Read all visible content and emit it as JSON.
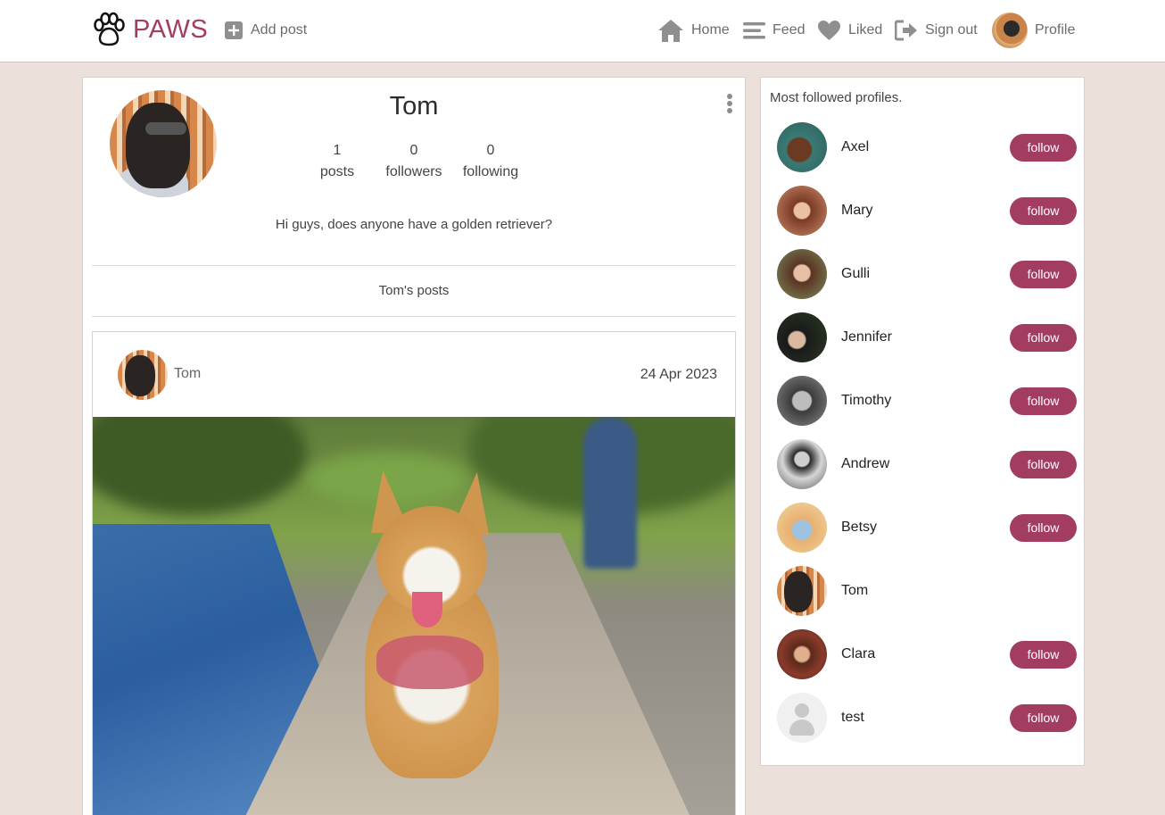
{
  "navbar": {
    "brand": "PAWS",
    "add_post": "Add post",
    "home": "Home",
    "feed": "Feed",
    "liked": "Liked",
    "sign_out": "Sign out",
    "profile": "Profile"
  },
  "profile": {
    "name": "Tom",
    "stats": [
      {
        "value": "1",
        "label": "posts"
      },
      {
        "value": "0",
        "label": "followers"
      },
      {
        "value": "0",
        "label": "following"
      }
    ],
    "bio": "Hi guys, does anyone have a golden retriever?",
    "posts_heading": "Tom's posts"
  },
  "post": {
    "author": "Tom",
    "date": "24 Apr 2023"
  },
  "sidebar": {
    "title": "Most followed profiles.",
    "follow_label": "follow",
    "profiles": [
      {
        "name": "Axel",
        "has_follow": true
      },
      {
        "name": "Mary",
        "has_follow": true
      },
      {
        "name": "Gulli",
        "has_follow": true
      },
      {
        "name": "Jennifer",
        "has_follow": true
      },
      {
        "name": "Timothy",
        "has_follow": true
      },
      {
        "name": "Andrew",
        "has_follow": true
      },
      {
        "name": "Betsy",
        "has_follow": true
      },
      {
        "name": "Tom",
        "has_follow": false
      },
      {
        "name": "Clara",
        "has_follow": true
      },
      {
        "name": "test",
        "has_follow": true
      }
    ]
  },
  "colors": {
    "brand": "#a23d61",
    "background": "#ebe0da",
    "nav_text": "#6b6b6b"
  }
}
